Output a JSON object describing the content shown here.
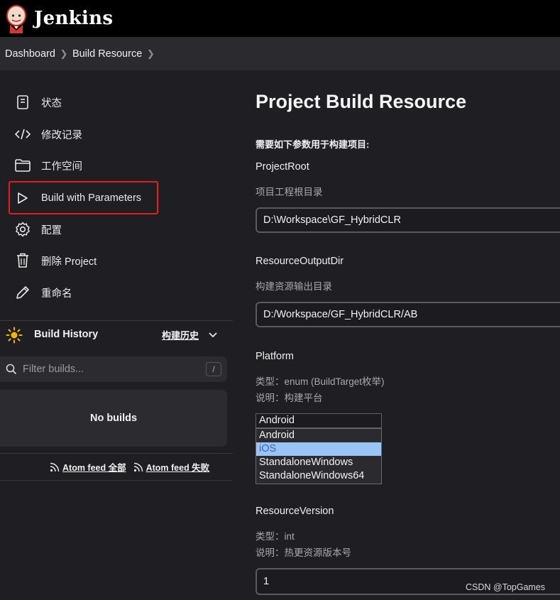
{
  "app": {
    "brand": "Jenkins",
    "icon": "jenkins-butler-logo"
  },
  "breadcrumb": [
    {
      "label": "Dashboard"
    },
    {
      "label": "Build Resource"
    }
  ],
  "sidebar": {
    "items": [
      {
        "label": "状态",
        "icon": "document-icon"
      },
      {
        "label": "修改记录",
        "icon": "code-icon"
      },
      {
        "label": "工作空间",
        "icon": "folder-icon"
      },
      {
        "label": "Build with Parameters",
        "icon": "play-icon",
        "highlighted": true
      },
      {
        "label": "配置",
        "icon": "gear-icon"
      },
      {
        "label": "删除 Project",
        "icon": "trash-icon"
      },
      {
        "label": "重命名",
        "icon": "pencil-icon"
      }
    ]
  },
  "build_history": {
    "title": "Build History",
    "title_cn": "构建历史",
    "filter_placeholder": "Filter builds...",
    "shortcut": "/",
    "empty": "No builds",
    "feed_all": "Atom feed 全部",
    "feed_failed": "Atom feed 失败"
  },
  "main": {
    "title": "Project Build Resource",
    "description": "需要如下参数用于构建项目:",
    "params": {
      "project_root": {
        "name": "ProjectRoot",
        "help": "项目工程根目录",
        "value": "D:\\Workspace\\GF_HybridCLR"
      },
      "resource_output_dir": {
        "name": "ResourceOutputDir",
        "help": "构建资源输出目录",
        "value": "D:/Workspace/GF_HybridCLR/AB"
      },
      "platform": {
        "name": "Platform",
        "type_line": "类型：enum (BuildTarget枚举)",
        "desc_line": "说明：构建平台",
        "selected": "Android",
        "options": [
          "Android",
          "iOS",
          "StandaloneWindows",
          "StandaloneWindows64"
        ],
        "hovered_option": "iOS"
      },
      "resource_version": {
        "name": "ResourceVersion",
        "type_line": "类型：int",
        "desc_line": "说明：热更资源版本号",
        "value": "1"
      }
    }
  },
  "watermark": "CSDN @TopGames",
  "colors": {
    "highlight_border": "#e0201c",
    "dropdown_hover": "#9ac4f5",
    "background": "#1f1f23"
  }
}
